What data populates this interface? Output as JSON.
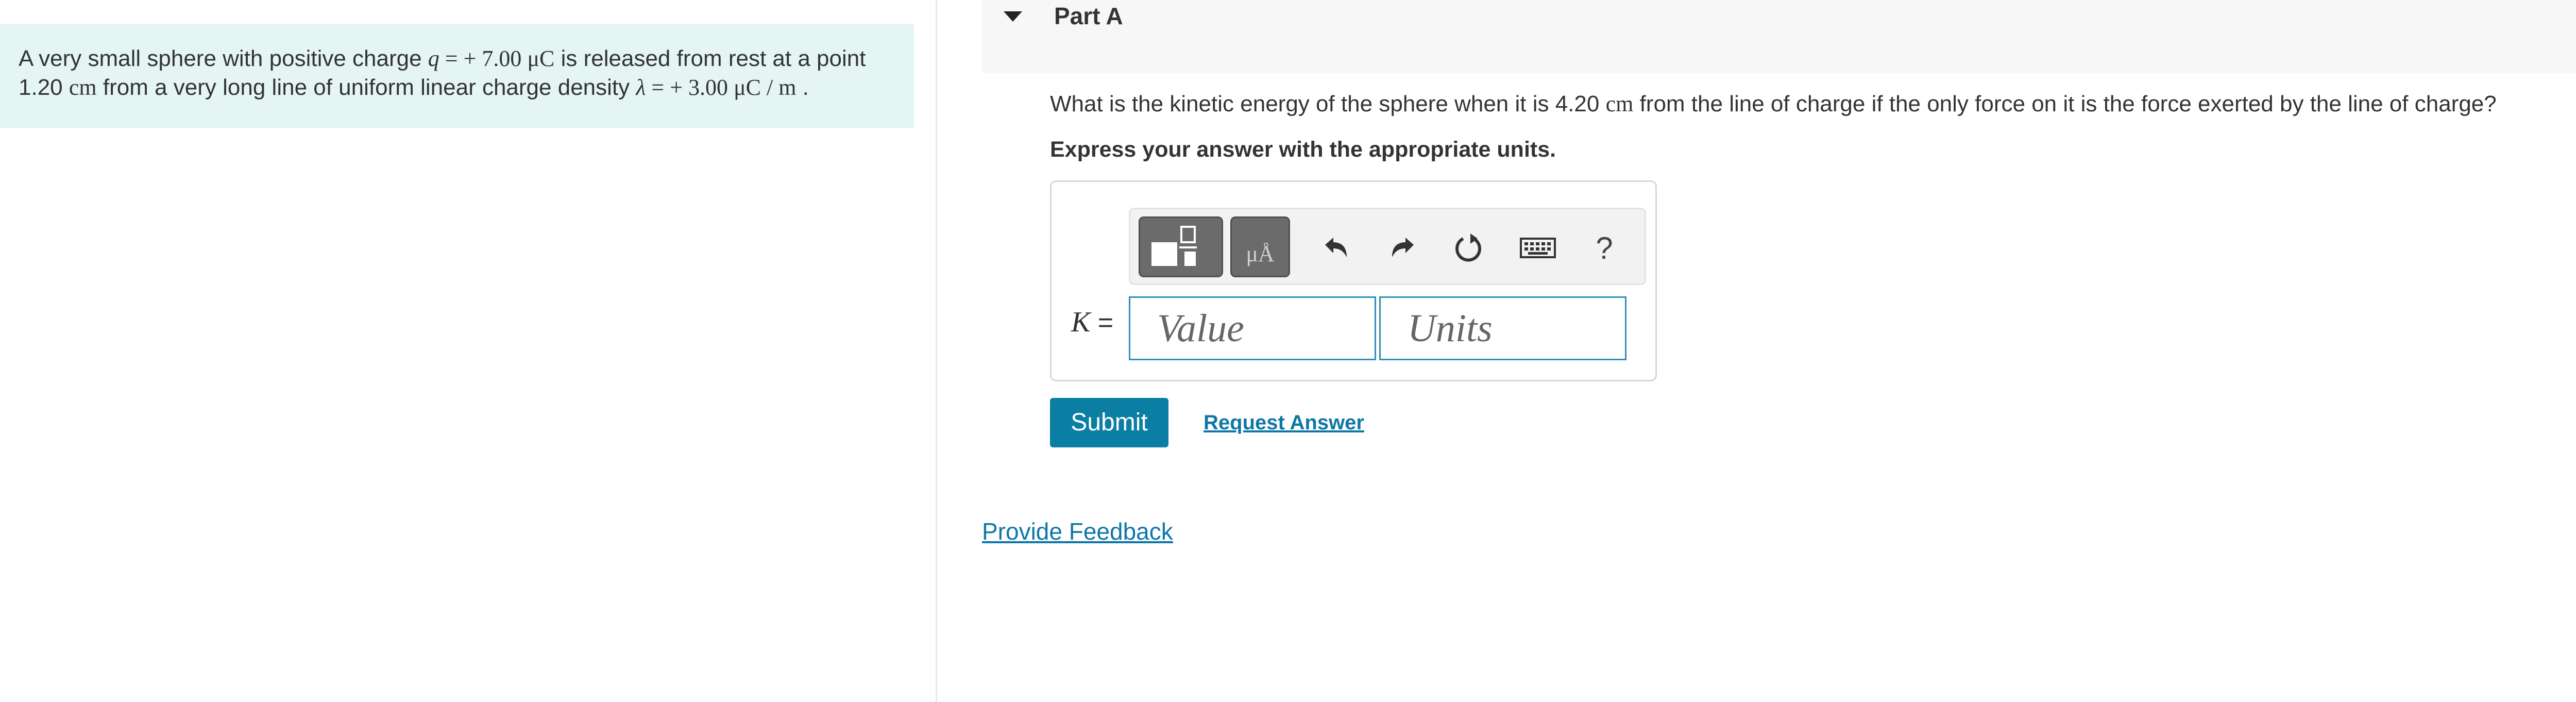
{
  "problem": {
    "segments": [
      "A very small sphere with positive charge ",
      "q",
      " = + 7.00 ",
      "μC",
      " is released from rest at a point",
      "1.20 ",
      "cm",
      " from a very long line of uniform linear charge density ",
      "λ",
      " = + 3.00 ",
      "μC / m",
      " ."
    ]
  },
  "part": {
    "title": "Part A"
  },
  "question": {
    "before": "What is the kinetic energy of the sphere when it is 4.20 ",
    "unit": "cm",
    "after": " from the line of charge if the only force on it is the force exerted by the line of charge?",
    "instruction": "Express your answer with the appropriate units."
  },
  "toolbar": {
    "units_glyph": "μÅ",
    "help_label": "?",
    "icons": [
      "templates-icon",
      "units-icon",
      "undo-icon",
      "redo-icon",
      "reset-icon",
      "keyboard-icon",
      "help-icon"
    ]
  },
  "answer": {
    "variable": "K",
    "equals": " =",
    "value_placeholder": "Value",
    "units_placeholder": "Units"
  },
  "actions": {
    "submit_label": "Submit",
    "request_answer_label": "Request Answer",
    "feedback_label": "Provide Feedback"
  },
  "colors": {
    "problem_bg": "#e4f5f4",
    "accent": "#0b7ea3",
    "link": "#0e77a8",
    "field_border": "#2f8fb6"
  }
}
